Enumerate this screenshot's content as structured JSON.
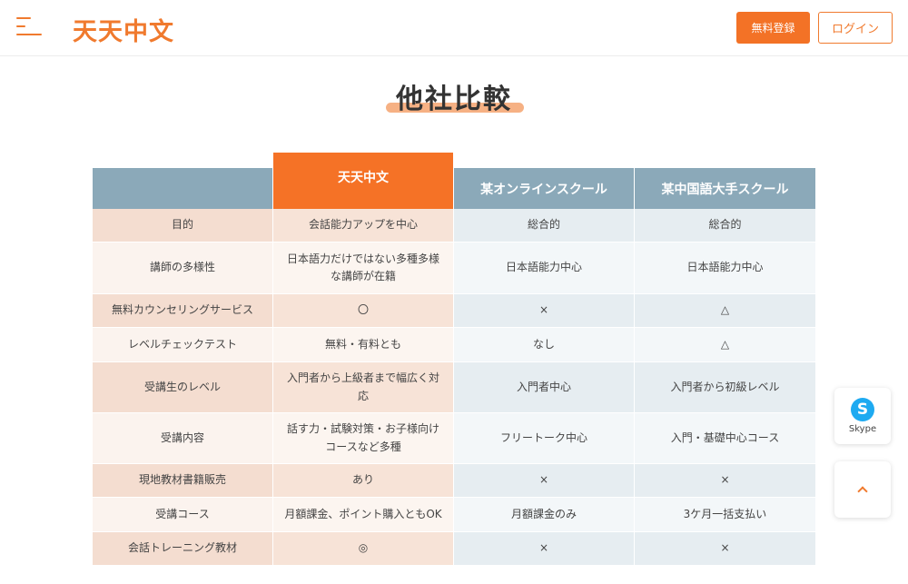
{
  "header": {
    "logo": "天天中文",
    "register_label": "無料登録",
    "login_label": "ログイン"
  },
  "page": {
    "title": "他社比較"
  },
  "comparison": {
    "columns": [
      "",
      "天天中文",
      "某オンラインスクール",
      "某中国語大手スクール"
    ],
    "rows": [
      {
        "label": "目的",
        "ours": "会話能力アップを中心",
        "a": "総合的",
        "b": "総合的"
      },
      {
        "label": "講師の多様性",
        "ours": "日本語力だけではない多種多様な講師が在籍",
        "a": "日本語能力中心",
        "b": "日本語能力中心"
      },
      {
        "label": "無料カウンセリングサービス",
        "ours": "〇",
        "a": "×",
        "b": "△"
      },
      {
        "label": "レベルチェックテスト",
        "ours": "無料・有料とも",
        "a": "なし",
        "b": "△"
      },
      {
        "label": "受講生のレベル",
        "ours": "入門者から上級者まで幅広く対応",
        "a": "入門者中心",
        "b": "入門者から初級レベル"
      },
      {
        "label": "受講内容",
        "ours": "話す力・試験対策・お子様向けコースなど多種",
        "a": "フリートーク中心",
        "b": "入門・基礎中心コース"
      },
      {
        "label": "現地教材書籍販売",
        "ours": "あり",
        "a": "×",
        "b": "×"
      },
      {
        "label": "受講コース",
        "ours": "月額課金、ポイント購入ともOK",
        "a": "月額課金のみ",
        "b": "3ケ月一括支払い"
      },
      {
        "label": "会話トレーニング教材",
        "ours": "◎",
        "a": "×",
        "b": "×"
      }
    ]
  },
  "floating": {
    "skype_label": "Skype",
    "skype_glyph": "S"
  },
  "colors": {
    "brand_orange": "#f37226",
    "header_blue": "#8ba9b9"
  }
}
